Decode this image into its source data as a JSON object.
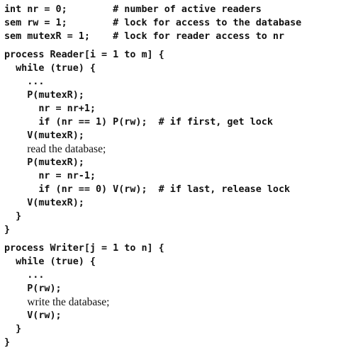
{
  "code_lines": {
    "l01": "int nr = 0;        # number of active readers",
    "l02": "sem rw = 1;        # lock for access to the database",
    "l03": "sem mutexR = 1;    # lock for reader access to nr",
    "l04": "process Reader[i = 1 to m] {",
    "l05": "  while (true) {",
    "l06": "    ...",
    "l07": "    P(mutexR);",
    "l08": "      nr = nr+1;",
    "l09": "      if (nr == 1) P(rw);  # if first, get lock",
    "l10": "    V(mutexR);",
    "l11": "read the database;",
    "l12": "    P(mutexR);",
    "l13": "      nr = nr-1;",
    "l14": "      if (nr == 0) V(rw);  # if last, release lock",
    "l15": "    V(mutexR);",
    "l16": "  }",
    "l17": "}",
    "l18": "process Writer[j = 1 to n] {",
    "l19": "  while (true) {",
    "l20": "    ...",
    "l21": "    P(rw);",
    "l22": "write the database;",
    "l23": "    V(rw);",
    "l24": "  }",
    "l25": "}"
  }
}
